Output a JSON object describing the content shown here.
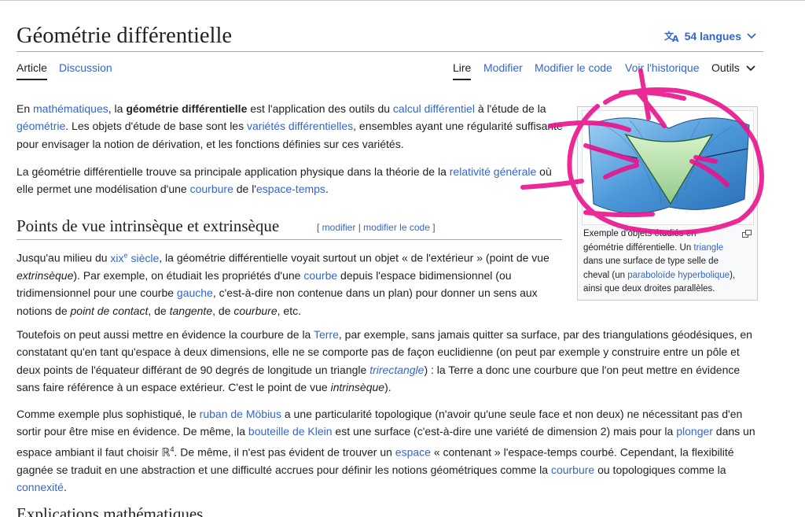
{
  "page": {
    "title": "Géométrie différentielle",
    "languages_label": "54 langues"
  },
  "tabs": {
    "article": "Article",
    "discussion": "Discussion",
    "read": "Lire",
    "edit": "Modifier",
    "edit_source": "Modifier le code",
    "history": "Voir l'historique",
    "tools": "Outils"
  },
  "intro": {
    "p1": {
      "t1": "En ",
      "l1": "mathématiques",
      "t2": ", la ",
      "b1": "géométrie différentielle",
      "t3": " est l'application des outils du ",
      "l2": "calcul différentiel",
      "t4": " à l'étude de la",
      "l3": "géométrie",
      "t5": ". Les objets d'étude de base sont les ",
      "l4": "variétés différentielles",
      "t6": ", ensembles ayant une régularité suffisante",
      "t7": "pour envisager la notion de dérivation, et les fonctions définies sur ces variétés."
    },
    "p2": {
      "t1": "La géométrie différentielle trouve sa principale application physique dans la théorie de la ",
      "l1": "relativité générale",
      "t2": " où",
      "t3": "elle permet une modélisation d'une ",
      "l2": "courbure",
      "t4": " de l'",
      "l3": "espace-temps",
      "t5": "."
    }
  },
  "section1": {
    "heading": "Points de vue intrinsèque et extrinsèque",
    "edit_open": "[ ",
    "edit_link": "modifier",
    "edit_sep": " | ",
    "edit_code_link": "modifier le code",
    "edit_close": " ]",
    "p1": {
      "t1": "Jusqu'au milieu du ",
      "l1": "xix",
      "l1sup": "e",
      "l1b": " siècle",
      "t2": ", la géométrie différentielle voyait surtout un objet « de l'extérieur » (point de vue",
      "i1": "extrinsèque",
      "t3": "). Par exemple, on étudiait les propriétés d'une ",
      "l2": "courbe",
      "t4": " depuis l'espace bidimensionnel (ou",
      "t5": "tridimensionnel pour une courbe ",
      "l3": "gauche",
      "t6": ", c'est-à-dire non contenue dans un plan) pour donner un sens aux",
      "t7": "notions de ",
      "i2": "point de contact",
      "t8": ", de ",
      "i3": "tangente",
      "t9": ", de ",
      "i4": "courbure",
      "t10": ", etc."
    },
    "p2": {
      "t1": "Toutefois on peut aussi mettre en évidence la courbure de la ",
      "l1": "Terre",
      "t2": ", par exemple, sans jamais quitter sa surface, par des triangulations géodésiques, en",
      "t3": "constatant qu'en tant qu'espace à deux dimensions, elle ne se comporte pas de façon euclidienne (on peut par exemple y construire entre un pôle et",
      "t4": "deux points de l'équateur différant de 90 degrés de longitude un triangle ",
      "l2": "trirectangle",
      "t5": ") : la Terre a donc une courbure que l'on peut mettre en évidence",
      "t6": "sans faire référence à un espace extérieur. C'est le point de vue ",
      "i1": "intrinsèque",
      "t7": ")."
    },
    "p3": {
      "t1": "Comme exemple plus sophistiqué, le ",
      "l1": "ruban de Möbius",
      "t2": " a une particularité topologique (n'avoir qu'une seule face et non deux) ne nécessitant pas d'en",
      "t3": "sortir pour être mise en évidence. De même, la ",
      "l2": "bouteille de Klein",
      "t4": " est une surface (c'est-à-dire une variété de dimension 2) mais pour la ",
      "l3": "plonger",
      "t5": " dans un",
      "t6": "espace ambiant il faut choisir ℝ",
      "t6sup": "4",
      "t7": ". De même, il n'est pas évident de trouver un ",
      "l4": "espace",
      "t8": " « contenant » l'espace-temps courbé. Cependant, la flexibilité",
      "t9": "gagnée se traduit en une abstraction et une difficulté accrues pour définir les notions géométriques comme la ",
      "l5": "courbure",
      "t10": " ou topologiques comme la",
      "l6": "connexité",
      "t11": "."
    }
  },
  "thumb": {
    "cap_t1": "Exemple d'objets étudiés en",
    "cap_t2": "géométrie différentielle. Un ",
    "cap_l1": "triangle",
    "cap_t3": "dans une surface de type selle de",
    "cap_t4": "cheval (un ",
    "cap_l2": "paraboloïde hyperbolique",
    "cap_t5": "),",
    "cap_t6": "ainsi que deux droites parallèles."
  },
  "section2": {
    "heading": "Explications mathématiques"
  },
  "colors": {
    "link": "#3366cc",
    "annotation": "#e8148c",
    "surface": "#5aa6e0"
  }
}
